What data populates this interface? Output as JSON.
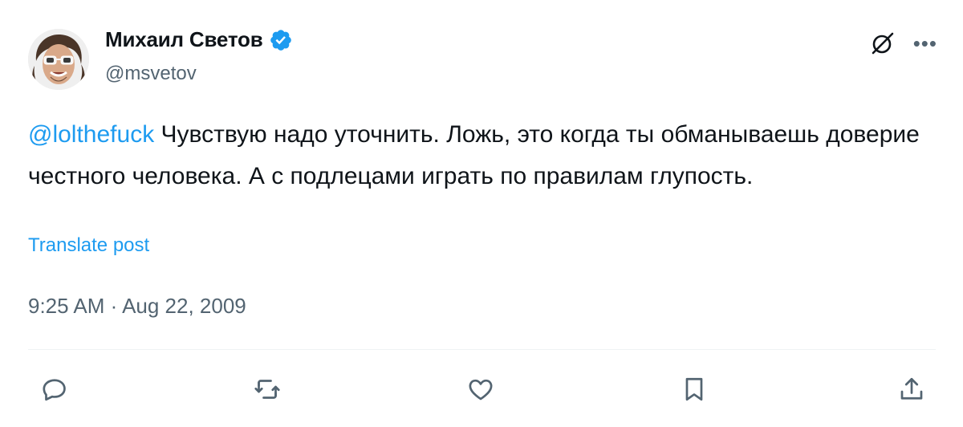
{
  "author": {
    "display_name": "Михаил Светов",
    "handle": "@msvetov",
    "verified": true
  },
  "tweet": {
    "mention": "@lolthefuck",
    "body": " Чувствую надо уточнить. Ложь, это когда ты обманываешь доверие честного человека. А с подлецами играть по правилам глупость.",
    "translate_label": "Translate post",
    "timestamp": "9:25 AM · Aug 22, 2009"
  },
  "icons": {
    "grok": "grok-icon",
    "more": "more-icon",
    "reply": "reply-icon",
    "retweet": "retweet-icon",
    "like": "like-icon",
    "bookmark": "bookmark-icon",
    "share": "share-icon"
  },
  "colors": {
    "accent": "#1d9bf0",
    "text": "#0f1419",
    "secondary": "#536471",
    "divider": "#eff3f4"
  }
}
